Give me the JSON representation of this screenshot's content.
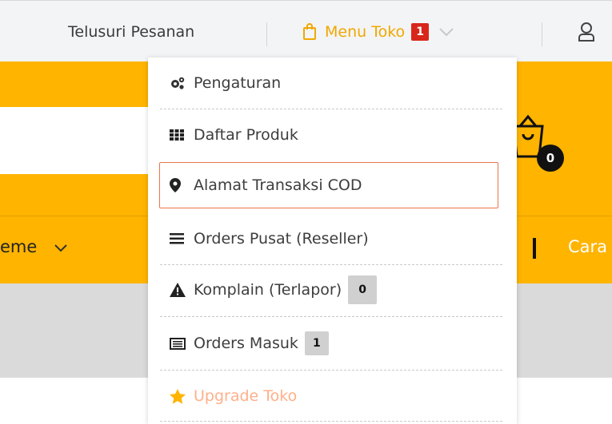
{
  "header": {
    "search_orders": "Telusuri Pesanan",
    "menu_toko": "Menu Toko",
    "menu_toko_badge": "1"
  },
  "nav": {
    "theme_partial": "eme",
    "cara_partial": "Cara",
    "cart_count": "0"
  },
  "dropdown": {
    "items": [
      {
        "label": "Pengaturan",
        "icon": "gears-icon"
      },
      {
        "label": "Daftar Produk",
        "icon": "grid-icon"
      },
      {
        "label": "Alamat Transaksi COD",
        "icon": "map-marker-icon"
      },
      {
        "label": "Orders Pusat (Reseller)",
        "icon": "list-icon"
      },
      {
        "label": "Komplain (Terlapor)",
        "icon": "warning-icon",
        "count": "0"
      },
      {
        "label": "Orders Masuk",
        "icon": "inbox-icon",
        "count": "1"
      },
      {
        "label": "Upgrade Toko",
        "icon": "star-icon"
      }
    ]
  },
  "colors": {
    "accent_yellow": "#ffb400",
    "badge_red": "#d9261c",
    "highlight_border": "#e8764a"
  }
}
